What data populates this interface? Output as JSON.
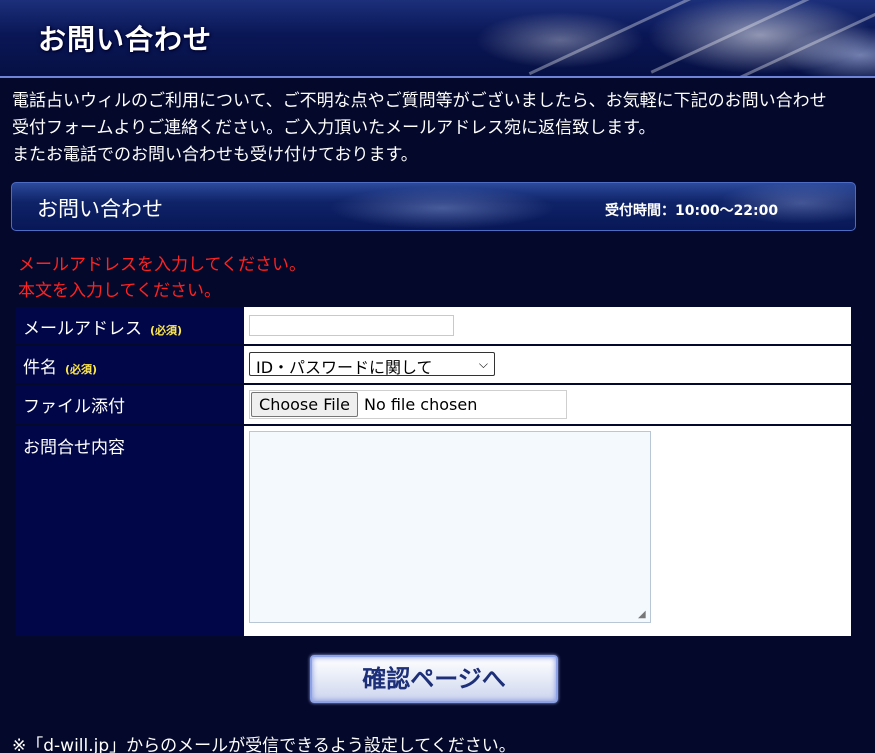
{
  "header": {
    "title": "お問い合わせ"
  },
  "intro": {
    "line1": "電話占いウィルのご利用について、ご不明な点やご質問等がございましたら、お気軽に下記のお問い合わせ",
    "line2": "受付フォームよりご連絡ください。ご入力頂いたメールアドレス宛に返信致します。",
    "line3": "またお電話でのお問い合わせも受け付けております。"
  },
  "section": {
    "title": "お問い合わせ",
    "hours": "受付時間：10:00〜22:00"
  },
  "errors": [
    "メールアドレスを入力してください。",
    "本文を入力してください。"
  ],
  "form": {
    "required_label": "(必須)",
    "email": {
      "label": "メールアドレス",
      "value": ""
    },
    "subject": {
      "label": "件名",
      "selected": "ID・パスワードに関して"
    },
    "file": {
      "label": "ファイル添付",
      "button": "Choose File",
      "status": "No file chosen"
    },
    "body": {
      "label": "お問合せ内容",
      "value": ""
    },
    "confirm_button": "確認ページへ"
  },
  "footnote": "※「d-will.jp」からのメールが受信できるよう設定してください。",
  "colors": {
    "background": "#04082a",
    "label_cell": "#000647",
    "error": "#ff2222",
    "required": "#ffe94a"
  }
}
